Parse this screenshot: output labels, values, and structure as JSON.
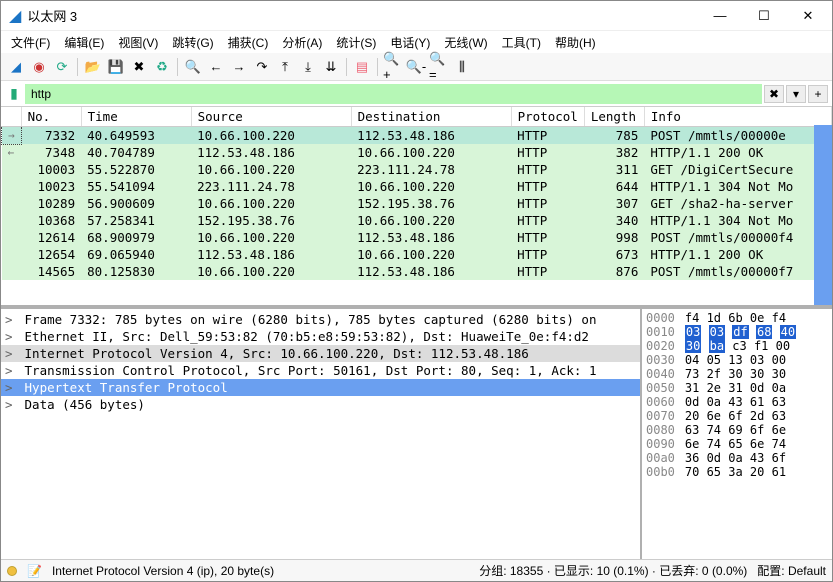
{
  "window": {
    "title": "以太网 3"
  },
  "menu": {
    "file": "文件(F)",
    "edit": "编辑(E)",
    "view": "视图(V)",
    "goto": "跳转(G)",
    "capture": "捕获(C)",
    "analyze": "分析(A)",
    "stats": "统计(S)",
    "tele": "电话(Y)",
    "wireless": "无线(W)",
    "tools": "工具(T)",
    "help": "帮助(H)"
  },
  "filter": {
    "value": "http"
  },
  "columns": {
    "no": "No.",
    "time": "Time",
    "source": "Source",
    "dest": "Destination",
    "proto": "Protocol",
    "len": "Length",
    "info": "Info"
  },
  "packets": [
    {
      "no": "7332",
      "time": "40.649593",
      "src": "10.66.100.220",
      "dst": "112.53.48.186",
      "proto": "HTTP",
      "len": "785",
      "info": "POST /mmtls/00000e",
      "sel": true,
      "arrow": "→"
    },
    {
      "no": "7348",
      "time": "40.704789",
      "src": "112.53.48.186",
      "dst": "10.66.100.220",
      "proto": "HTTP",
      "len": "382",
      "info": "HTTP/1.1 200 OK",
      "arrow": "←"
    },
    {
      "no": "10003",
      "time": "55.522870",
      "src": "10.66.100.220",
      "dst": "223.111.24.78",
      "proto": "HTTP",
      "len": "311",
      "info": "GET /DigiCertSecure"
    },
    {
      "no": "10023",
      "time": "55.541094",
      "src": "223.111.24.78",
      "dst": "10.66.100.220",
      "proto": "HTTP",
      "len": "644",
      "info": "HTTP/1.1 304 Not Mo"
    },
    {
      "no": "10289",
      "time": "56.900609",
      "src": "10.66.100.220",
      "dst": "152.195.38.76",
      "proto": "HTTP",
      "len": "307",
      "info": "GET /sha2-ha-server"
    },
    {
      "no": "10368",
      "time": "57.258341",
      "src": "152.195.38.76",
      "dst": "10.66.100.220",
      "proto": "HTTP",
      "len": "340",
      "info": "HTTP/1.1 304 Not Mo"
    },
    {
      "no": "12614",
      "time": "68.900979",
      "src": "10.66.100.220",
      "dst": "112.53.48.186",
      "proto": "HTTP",
      "len": "998",
      "info": "POST /mmtls/00000f4"
    },
    {
      "no": "12654",
      "time": "69.065940",
      "src": "112.53.48.186",
      "dst": "10.66.100.220",
      "proto": "HTTP",
      "len": "673",
      "info": "HTTP/1.1 200 OK"
    },
    {
      "no": "14565",
      "time": "80.125830",
      "src": "10.66.100.220",
      "dst": "112.53.48.186",
      "proto": "HTTP",
      "len": "876",
      "info": "POST /mmtls/00000f7"
    }
  ],
  "tree": [
    {
      "t": "Frame 7332: 785 bytes on wire (6280 bits), 785 bytes captured (6280 bits) on",
      "exp": ">"
    },
    {
      "t": "Ethernet II, Src: Dell_59:53:82 (70:b5:e8:59:53:82), Dst: HuaweiTe_0e:f4:d2",
      "exp": ">"
    },
    {
      "t": "Internet Protocol Version 4, Src: 10.66.100.220, Dst: 112.53.48.186",
      "exp": ">",
      "sel": "sel2"
    },
    {
      "t": "Transmission Control Protocol, Src Port: 50161, Dst Port: 80, Seq: 1, Ack: 1",
      "exp": ">"
    },
    {
      "t": "Hypertext Transfer Protocol",
      "exp": ">",
      "sel": "sel"
    },
    {
      "t": "Data (456 bytes)",
      "exp": ">"
    }
  ],
  "hex": [
    {
      "off": "0000",
      "b": "f4 1d 6b 0e f4"
    },
    {
      "off": "0010",
      "b": "03 03 df 68 40",
      "hl": [
        0,
        1,
        2,
        3,
        4
      ]
    },
    {
      "off": "0020",
      "b": "30 ba c3 f1 00",
      "hl": [
        0,
        1
      ]
    },
    {
      "off": "0030",
      "b": "04 05 13 03 00"
    },
    {
      "off": "0040",
      "b": "73 2f 30 30 30"
    },
    {
      "off": "0050",
      "b": "31 2e 31 0d 0a"
    },
    {
      "off": "0060",
      "b": "0d 0a 43 61 63"
    },
    {
      "off": "0070",
      "b": "20 6e 6f 2d 63"
    },
    {
      "off": "0080",
      "b": "63 74 69 6f 6e"
    },
    {
      "off": "0090",
      "b": "6e 74 65 6e 74"
    },
    {
      "off": "00a0",
      "b": "36 0d 0a 43 6f"
    },
    {
      "off": "00b0",
      "b": "70 65 3a 20 61"
    }
  ],
  "status": {
    "left": "Internet Protocol Version 4 (ip), 20 byte(s)",
    "mid": "分组: 18355 · 已显示: 10 (0.1%) · 已丢弃: 0 (0.0%)",
    "right": "配置: Default"
  }
}
